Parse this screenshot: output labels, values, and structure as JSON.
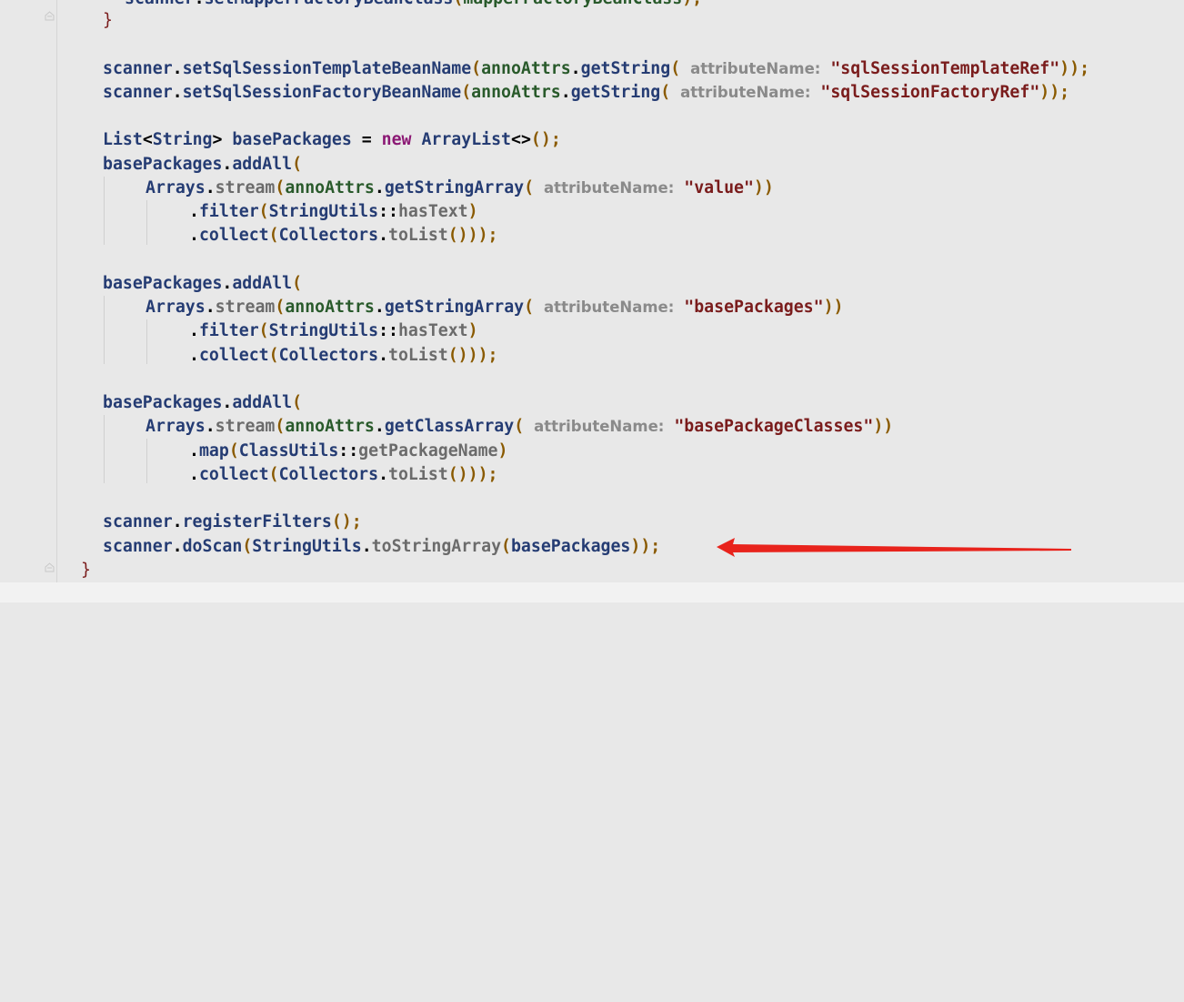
{
  "hint_label": "attributeName:",
  "lines": {
    "l0": {
      "a": "scanner",
      "b": ".",
      "c": "setMapperFactoryBeanClass",
      "d": "(",
      "e": "mapperFactoryBeanClass",
      "f": ");"
    },
    "l1": {
      "a": "}"
    },
    "l3": {
      "a": "scanner",
      "b": ".",
      "c": "setSqlSessionTemplateBeanName",
      "d": "(",
      "e": "annoAttrs",
      "f": ".",
      "g": "getString",
      "h": "(",
      "s": "\"sqlSessionTemplateRef\"",
      "i": "));"
    },
    "l4": {
      "a": "scanner",
      "b": ".",
      "c": "setSqlSessionFactoryBeanName",
      "d": "(",
      "e": "annoAttrs",
      "f": ".",
      "g": "getString",
      "h": "(",
      "s": "\"sqlSessionFactoryRef\"",
      "i": "));"
    },
    "l6": {
      "a": "List",
      "b": "<",
      "c": "String",
      "d": ">",
      "e": "basePackages",
      "f": "=",
      "k": "new",
      "g": "ArrayList",
      "h": "<>",
      "i": "();"
    },
    "l7": {
      "a": "basePackages",
      "b": ".",
      "c": "addAll",
      "d": "("
    },
    "l8": {
      "a": "Arrays",
      "b": ".",
      "c": "stream",
      "d": "(",
      "e": "annoAttrs",
      "f": ".",
      "g": "getStringArray",
      "h": "(",
      "s": "\"value\"",
      "i": "))"
    },
    "l9": {
      "a": ".",
      "b": "filter",
      "c": "(",
      "d": "StringUtils",
      "e": "::",
      "f": "hasText",
      "g": ")"
    },
    "l10": {
      "a": ".",
      "b": "collect",
      "c": "(",
      "d": "Collectors",
      "e": ".",
      "f": "toList",
      "g": "()));"
    },
    "l12": {
      "a": "basePackages",
      "b": ".",
      "c": "addAll",
      "d": "("
    },
    "l13": {
      "a": "Arrays",
      "b": ".",
      "c": "stream",
      "d": "(",
      "e": "annoAttrs",
      "f": ".",
      "g": "getStringArray",
      "h": "(",
      "s": "\"basePackages\"",
      "i": "))"
    },
    "l14": {
      "a": ".",
      "b": "filter",
      "c": "(",
      "d": "StringUtils",
      "e": "::",
      "f": "hasText",
      "g": ")"
    },
    "l15": {
      "a": ".",
      "b": "collect",
      "c": "(",
      "d": "Collectors",
      "e": ".",
      "f": "toList",
      "g": "()));"
    },
    "l17": {
      "a": "basePackages",
      "b": ".",
      "c": "addAll",
      "d": "("
    },
    "l18": {
      "a": "Arrays",
      "b": ".",
      "c": "stream",
      "d": "(",
      "e": "annoAttrs",
      "f": ".",
      "g": "getClassArray",
      "h": "(",
      "s": "\"basePackageClasses\"",
      "i": "))"
    },
    "l19": {
      "a": ".",
      "b": "map",
      "c": "(",
      "d": "ClassUtils",
      "e": "::",
      "f": "getPackageName",
      "g": ")"
    },
    "l20": {
      "a": ".",
      "b": "collect",
      "c": "(",
      "d": "Collectors",
      "e": ".",
      "f": "toList",
      "g": "()));"
    },
    "l22": {
      "a": "scanner",
      "b": ".",
      "c": "registerFilters",
      "d": "();"
    },
    "l23": {
      "a": "scanner",
      "b": ".",
      "c": "doScan",
      "d": "(",
      "e": "StringUtils",
      "f": ".",
      "g": "toStringArray",
      "h": "(",
      "j": "basePackages",
      "i": "));"
    },
    "l24": {
      "a": "}"
    }
  },
  "colors": {
    "arrow": "#e8231c"
  }
}
